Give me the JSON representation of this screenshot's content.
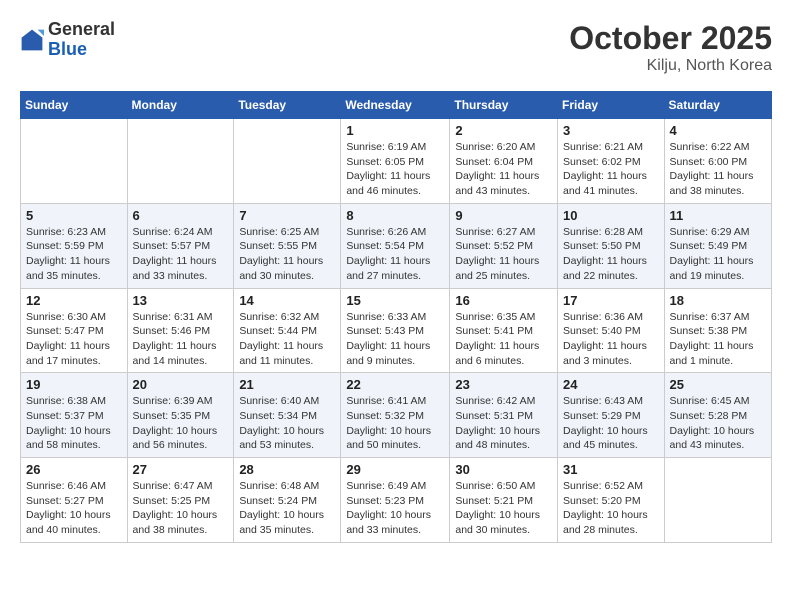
{
  "header": {
    "logo_general": "General",
    "logo_blue": "Blue",
    "month_title": "October 2025",
    "location": "Kilju, North Korea"
  },
  "calendar": {
    "days_of_week": [
      "Sunday",
      "Monday",
      "Tuesday",
      "Wednesday",
      "Thursday",
      "Friday",
      "Saturday"
    ],
    "weeks": [
      [
        {
          "day": "",
          "info": ""
        },
        {
          "day": "",
          "info": ""
        },
        {
          "day": "",
          "info": ""
        },
        {
          "day": "1",
          "info": "Sunrise: 6:19 AM\nSunset: 6:05 PM\nDaylight: 11 hours and 46 minutes."
        },
        {
          "day": "2",
          "info": "Sunrise: 6:20 AM\nSunset: 6:04 PM\nDaylight: 11 hours and 43 minutes."
        },
        {
          "day": "3",
          "info": "Sunrise: 6:21 AM\nSunset: 6:02 PM\nDaylight: 11 hours and 41 minutes."
        },
        {
          "day": "4",
          "info": "Sunrise: 6:22 AM\nSunset: 6:00 PM\nDaylight: 11 hours and 38 minutes."
        }
      ],
      [
        {
          "day": "5",
          "info": "Sunrise: 6:23 AM\nSunset: 5:59 PM\nDaylight: 11 hours and 35 minutes."
        },
        {
          "day": "6",
          "info": "Sunrise: 6:24 AM\nSunset: 5:57 PM\nDaylight: 11 hours and 33 minutes."
        },
        {
          "day": "7",
          "info": "Sunrise: 6:25 AM\nSunset: 5:55 PM\nDaylight: 11 hours and 30 minutes."
        },
        {
          "day": "8",
          "info": "Sunrise: 6:26 AM\nSunset: 5:54 PM\nDaylight: 11 hours and 27 minutes."
        },
        {
          "day": "9",
          "info": "Sunrise: 6:27 AM\nSunset: 5:52 PM\nDaylight: 11 hours and 25 minutes."
        },
        {
          "day": "10",
          "info": "Sunrise: 6:28 AM\nSunset: 5:50 PM\nDaylight: 11 hours and 22 minutes."
        },
        {
          "day": "11",
          "info": "Sunrise: 6:29 AM\nSunset: 5:49 PM\nDaylight: 11 hours and 19 minutes."
        }
      ],
      [
        {
          "day": "12",
          "info": "Sunrise: 6:30 AM\nSunset: 5:47 PM\nDaylight: 11 hours and 17 minutes."
        },
        {
          "day": "13",
          "info": "Sunrise: 6:31 AM\nSunset: 5:46 PM\nDaylight: 11 hours and 14 minutes."
        },
        {
          "day": "14",
          "info": "Sunrise: 6:32 AM\nSunset: 5:44 PM\nDaylight: 11 hours and 11 minutes."
        },
        {
          "day": "15",
          "info": "Sunrise: 6:33 AM\nSunset: 5:43 PM\nDaylight: 11 hours and 9 minutes."
        },
        {
          "day": "16",
          "info": "Sunrise: 6:35 AM\nSunset: 5:41 PM\nDaylight: 11 hours and 6 minutes."
        },
        {
          "day": "17",
          "info": "Sunrise: 6:36 AM\nSunset: 5:40 PM\nDaylight: 11 hours and 3 minutes."
        },
        {
          "day": "18",
          "info": "Sunrise: 6:37 AM\nSunset: 5:38 PM\nDaylight: 11 hours and 1 minute."
        }
      ],
      [
        {
          "day": "19",
          "info": "Sunrise: 6:38 AM\nSunset: 5:37 PM\nDaylight: 10 hours and 58 minutes."
        },
        {
          "day": "20",
          "info": "Sunrise: 6:39 AM\nSunset: 5:35 PM\nDaylight: 10 hours and 56 minutes."
        },
        {
          "day": "21",
          "info": "Sunrise: 6:40 AM\nSunset: 5:34 PM\nDaylight: 10 hours and 53 minutes."
        },
        {
          "day": "22",
          "info": "Sunrise: 6:41 AM\nSunset: 5:32 PM\nDaylight: 10 hours and 50 minutes."
        },
        {
          "day": "23",
          "info": "Sunrise: 6:42 AM\nSunset: 5:31 PM\nDaylight: 10 hours and 48 minutes."
        },
        {
          "day": "24",
          "info": "Sunrise: 6:43 AM\nSunset: 5:29 PM\nDaylight: 10 hours and 45 minutes."
        },
        {
          "day": "25",
          "info": "Sunrise: 6:45 AM\nSunset: 5:28 PM\nDaylight: 10 hours and 43 minutes."
        }
      ],
      [
        {
          "day": "26",
          "info": "Sunrise: 6:46 AM\nSunset: 5:27 PM\nDaylight: 10 hours and 40 minutes."
        },
        {
          "day": "27",
          "info": "Sunrise: 6:47 AM\nSunset: 5:25 PM\nDaylight: 10 hours and 38 minutes."
        },
        {
          "day": "28",
          "info": "Sunrise: 6:48 AM\nSunset: 5:24 PM\nDaylight: 10 hours and 35 minutes."
        },
        {
          "day": "29",
          "info": "Sunrise: 6:49 AM\nSunset: 5:23 PM\nDaylight: 10 hours and 33 minutes."
        },
        {
          "day": "30",
          "info": "Sunrise: 6:50 AM\nSunset: 5:21 PM\nDaylight: 10 hours and 30 minutes."
        },
        {
          "day": "31",
          "info": "Sunrise: 6:52 AM\nSunset: 5:20 PM\nDaylight: 10 hours and 28 minutes."
        },
        {
          "day": "",
          "info": ""
        }
      ]
    ]
  }
}
